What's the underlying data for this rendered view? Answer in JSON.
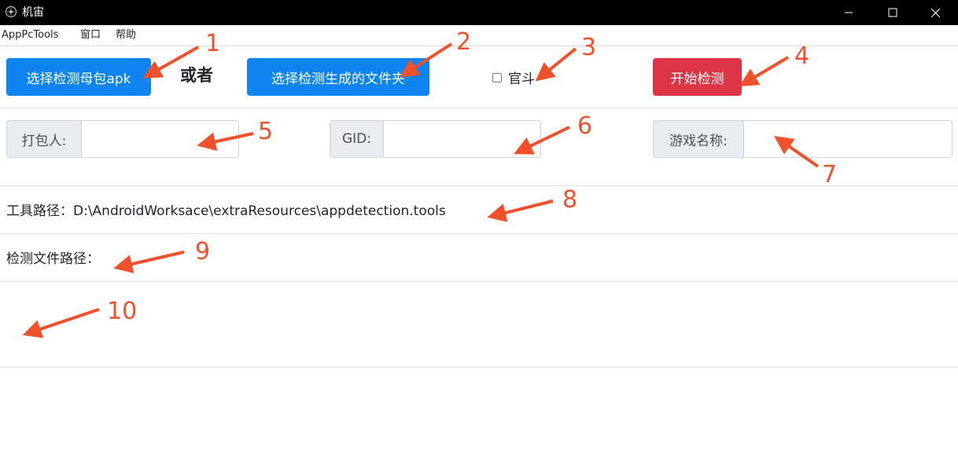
{
  "titlebar": {
    "title": "机宙",
    "minimize_glyph": "—",
    "close_glyph": "✕"
  },
  "menu": {
    "items": [
      "AppPcTools",
      "窗口",
      "帮助"
    ]
  },
  "toolbar": {
    "select_apk_label": "选择检测母包apk",
    "or_label": "或者",
    "select_folder_label": "选择检测生成的文件夹",
    "official_label": "官斗",
    "official_checked": false,
    "start_label": "开始检测"
  },
  "fields": {
    "packager_label": "打包人:",
    "packager_value": "",
    "gid_label": "GID:",
    "gid_value": "",
    "game_name_label": "游戏名称:",
    "game_name_value": ""
  },
  "paths": {
    "tool_path_label": "工具路径：",
    "tool_path_value": "D:\\AndroidWorksace\\extraResources\\appdetection.tools",
    "detect_path_label": "检测文件路径：",
    "detect_path_value": ""
  },
  "annotations": {
    "numbers": [
      "1",
      "2",
      "3",
      "4",
      "5",
      "6",
      "7",
      "8",
      "9",
      "10"
    ],
    "color": "#f0512b"
  },
  "colors": {
    "primary": "#0d84f0",
    "danger": "#dc3545",
    "titlebar": "#000000"
  }
}
